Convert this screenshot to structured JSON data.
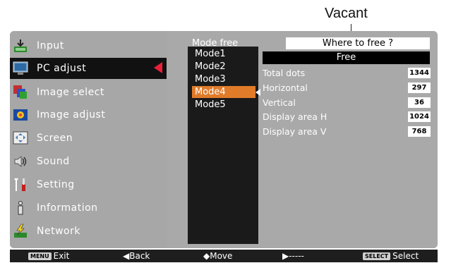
{
  "callout": {
    "label": "Vacant"
  },
  "menu": {
    "items": [
      {
        "label": "Input",
        "icon": "input-icon"
      },
      {
        "label": "PC adjust",
        "icon": "pc-adjust-icon",
        "active": true
      },
      {
        "label": "Image select",
        "icon": "image-select-icon"
      },
      {
        "label": "Image adjust",
        "icon": "image-adjust-icon"
      },
      {
        "label": "Screen",
        "icon": "screen-icon"
      },
      {
        "label": "Sound",
        "icon": "sound-icon"
      },
      {
        "label": "Setting",
        "icon": "setting-icon"
      },
      {
        "label": "Information",
        "icon": "information-icon"
      },
      {
        "label": "Network",
        "icon": "network-icon"
      }
    ]
  },
  "submenu": {
    "title": "Mode free",
    "modes": [
      "Mode1",
      "Mode2",
      "Mode3",
      "Mode4",
      "Mode5"
    ],
    "selected_mode": "Mode4",
    "where_prompt": "Where to free ?",
    "free_label": "Free"
  },
  "params": [
    {
      "label": "Total dots",
      "value": "1344"
    },
    {
      "label": "Horizontal",
      "value": "297"
    },
    {
      "label": "Vertical",
      "value": "36"
    },
    {
      "label": "Display area H",
      "value": "1024"
    },
    {
      "label": "Display area V",
      "value": "768"
    }
  ],
  "footer": {
    "exit_key": "MENU",
    "exit_label": "Exit",
    "back_label": "◀Back",
    "move_label": "◆Move",
    "next_label": "▶-----",
    "select_key": "SELECT",
    "select_label": "Select"
  },
  "colors": {
    "accent_orange": "#e07b2a",
    "accent_red": "#e8203a",
    "panel_gray": "#a9a9a9"
  }
}
